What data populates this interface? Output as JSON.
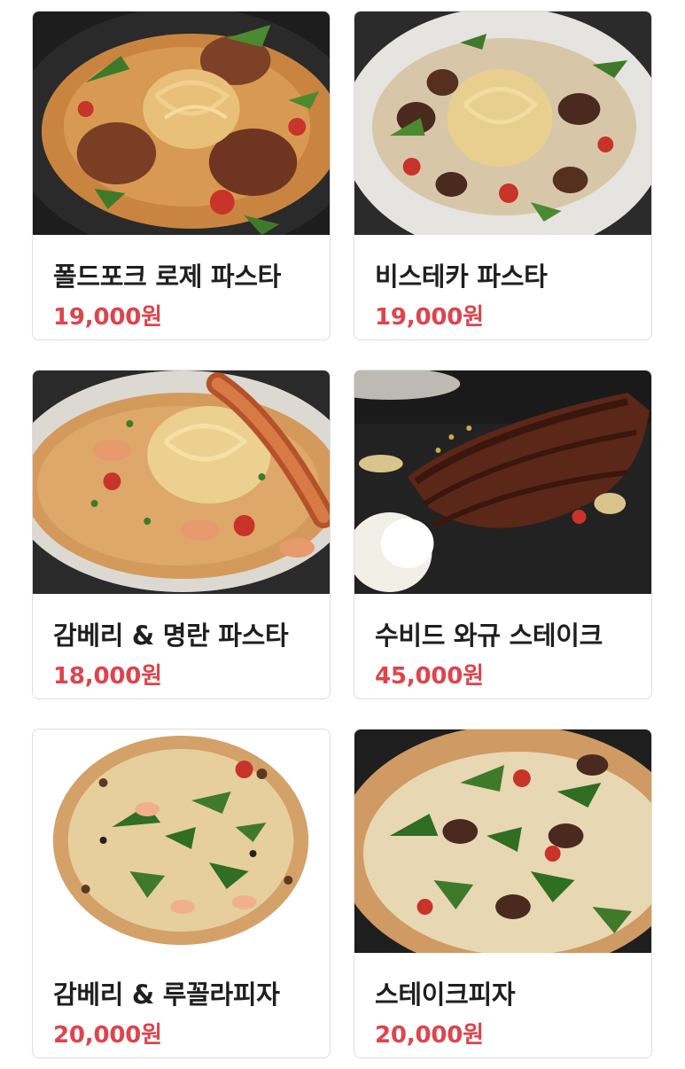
{
  "colors": {
    "price": "#e0434c",
    "name": "#1f1f1f",
    "card_border": "#dedede"
  },
  "menu": [
    {
      "name": "폴드포크 로제 파스타",
      "price": "19,000원",
      "image_icon": "rose-pasta-photo"
    },
    {
      "name": "비스테카 파스타",
      "price": "19,000원",
      "image_icon": "bistecca-pasta-photo"
    },
    {
      "name": "감베리 & 명란 파스타",
      "price": "18,000원",
      "image_icon": "shrimp-pasta-photo"
    },
    {
      "name": "수비드 와규 스테이크",
      "price": "45,000원",
      "image_icon": "wagyu-steak-photo"
    },
    {
      "name": "감베리 & 루꼴라피자",
      "price": "20,000원",
      "image_icon": "arugula-pizza-photo"
    },
    {
      "name": "스테이크피자",
      "price": "20,000원",
      "image_icon": "steak-pizza-photo"
    }
  ]
}
